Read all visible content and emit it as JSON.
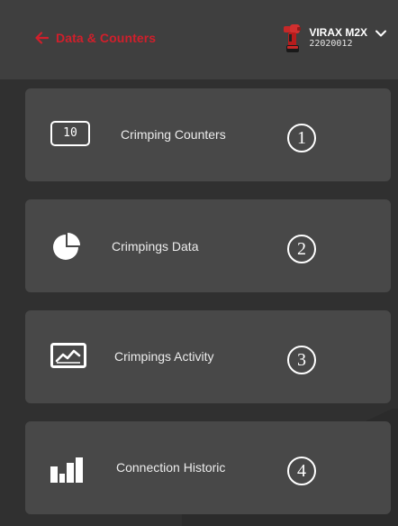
{
  "header": {
    "title": "Data & Counters",
    "back_icon": "arrow-left-icon",
    "accent_color": "#d11f2b",
    "device": {
      "name": "VIRAX M2X",
      "serial": "22020012",
      "icon": "crimping-tool-icon",
      "dropdown_icon": "chevron-down-icon"
    }
  },
  "menu": {
    "items": [
      {
        "label": "Crimping Counters",
        "number": "1",
        "icon": "counter-icon",
        "icon_text": "10"
      },
      {
        "label": "Crimpings Data",
        "number": "2",
        "icon": "pie-chart-icon"
      },
      {
        "label": "Crimpings Activity",
        "number": "3",
        "icon": "activity-chart-icon"
      },
      {
        "label": "Connection Historic",
        "number": "4",
        "icon": "bar-chart-icon"
      }
    ]
  }
}
